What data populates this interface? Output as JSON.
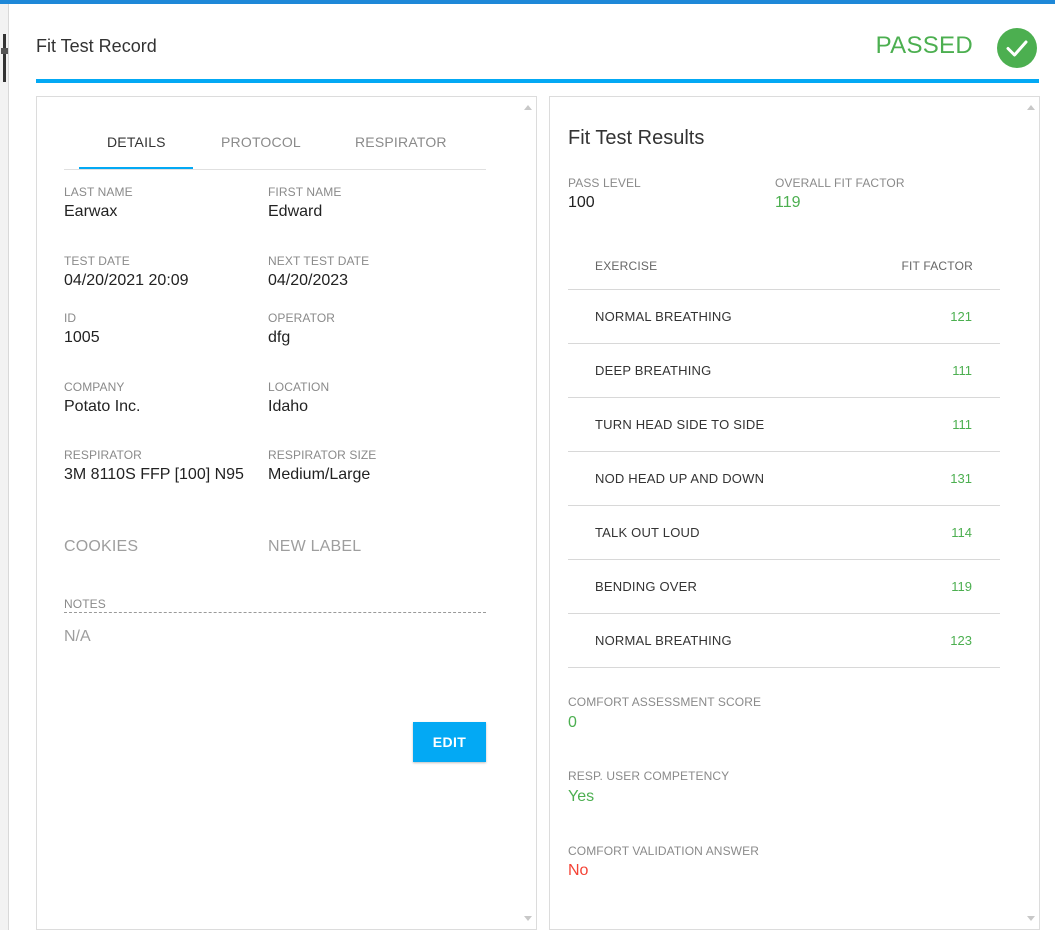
{
  "header": {
    "title": "Fit Test Record",
    "status": "PASSED"
  },
  "tabs": [
    {
      "label": "DETAILS"
    },
    {
      "label": "PROTOCOL"
    },
    {
      "label": "RESPIRATOR"
    }
  ],
  "details": {
    "last_name": {
      "label": "LAST NAME",
      "value": "Earwax"
    },
    "first_name": {
      "label": "FIRST NAME",
      "value": "Edward"
    },
    "test_date": {
      "label": "TEST DATE",
      "value": "04/20/2021 20:09"
    },
    "next_test_date": {
      "label": "NEXT TEST DATE",
      "value": "04/20/2023"
    },
    "id": {
      "label": "ID",
      "value": "1005"
    },
    "operator": {
      "label": "OPERATOR",
      "value": "dfg"
    },
    "company": {
      "label": "COMPANY",
      "value": "Potato Inc."
    },
    "location": {
      "label": "LOCATION",
      "value": "Idaho"
    },
    "respirator": {
      "label": "RESPIRATOR",
      "value": "3M 8110S FFP [100] N95"
    },
    "respirator_size": {
      "label": "RESPIRATOR SIZE",
      "value": "Medium/Large"
    },
    "cookies_label": "COOKIES",
    "new_label": "NEW LABEL",
    "notes": {
      "label": "NOTES",
      "value": "N/A"
    },
    "edit_label": "EDIT"
  },
  "results": {
    "title": "Fit Test Results",
    "pass_level": {
      "label": "PASS LEVEL",
      "value": "100"
    },
    "overall_fit_factor": {
      "label": "OVERALL FIT FACTOR",
      "value": "119"
    },
    "columns": {
      "exercise": "EXERCISE",
      "fit_factor": "FIT FACTOR"
    },
    "exercises": [
      {
        "name": "NORMAL BREATHING",
        "fit_factor": "121"
      },
      {
        "name": "DEEP BREATHING",
        "fit_factor": "111"
      },
      {
        "name": "TURN HEAD SIDE TO SIDE",
        "fit_factor": "111"
      },
      {
        "name": "NOD HEAD UP AND DOWN",
        "fit_factor": "131"
      },
      {
        "name": "TALK OUT LOUD",
        "fit_factor": "114"
      },
      {
        "name": "BENDING OVER",
        "fit_factor": "119"
      },
      {
        "name": "NORMAL BREATHING",
        "fit_factor": "123"
      }
    ],
    "comfort_score": {
      "label": "COMFORT ASSESSMENT SCORE",
      "value": "0"
    },
    "user_competency": {
      "label": "RESP. USER COMPETENCY",
      "value": "Yes"
    },
    "comfort_validation": {
      "label": "COMFORT VALIDATION ANSWER",
      "value": "No"
    }
  },
  "colors": {
    "accent": "#03a9f4",
    "pass": "#4caf50",
    "fail": "#f44336"
  },
  "icons": {
    "status": "check-circle-icon",
    "scroll_up": "scroll-up-arrow-icon",
    "scroll_down": "scroll-down-arrow-icon"
  }
}
